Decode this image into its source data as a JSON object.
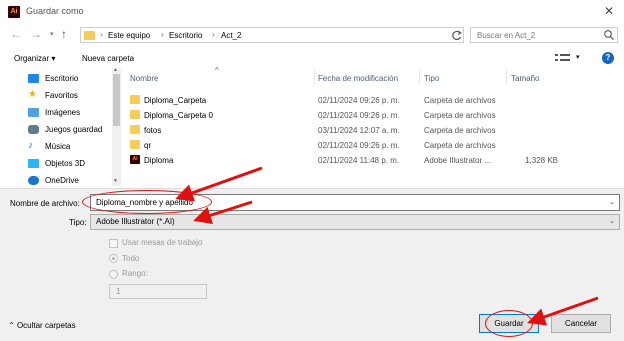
{
  "window": {
    "title": "Guardar como",
    "app_icon_text": "Ai",
    "close_glyph": "✕"
  },
  "nav": {
    "breadcrumbs": [
      "Este equipo",
      "Escritorio",
      "Act_2"
    ],
    "separator": "›",
    "search_placeholder": "Buscar en Act_2"
  },
  "toolbar": {
    "organize_label": "Organizar ▾",
    "new_folder_label": "Nueva carpeta",
    "help_label": "?"
  },
  "sidebar": {
    "items": [
      {
        "label": "Escritorio",
        "icon": "desktop-icon",
        "color": "#1e88e5"
      },
      {
        "label": "Favoritos",
        "icon": "star-icon",
        "color": "#f4b400"
      },
      {
        "label": "Imágenes",
        "icon": "pictures-icon",
        "color": "#4fa3e0"
      },
      {
        "label": "Juegos guardad",
        "icon": "saved-games-icon",
        "color": "#607d8b"
      },
      {
        "label": "Música",
        "icon": "music-icon",
        "color": "#1976d2"
      },
      {
        "label": "Objetos 3D",
        "icon": "objects-3d-icon",
        "color": "#29b6f6"
      },
      {
        "label": "OneDrive",
        "icon": "cloud-icon",
        "color": "#1976d2"
      }
    ]
  },
  "file_list": {
    "columns": [
      "Nombre",
      "Fecha de modificación",
      "Tipo",
      "Tamaño"
    ],
    "rows": [
      {
        "name": "Diploma_Carpeta",
        "date": "02/11/2024 09:26 p. m.",
        "type": "Carpeta de archivos",
        "size": "",
        "icon": "folder-icon"
      },
      {
        "name": "Diploma_Carpeta 0",
        "date": "02/11/2024 09:26 p. m.",
        "type": "Carpeta de archivos",
        "size": "",
        "icon": "folder-icon"
      },
      {
        "name": "fotos",
        "date": "03/11/2024 12:07 a. m.",
        "type": "Carpeta de archivos",
        "size": "",
        "icon": "folder-icon"
      },
      {
        "name": "qr",
        "date": "02/11/2024 09:26 p. m.",
        "type": "Carpeta de archivos",
        "size": "",
        "icon": "folder-icon"
      },
      {
        "name": "Diploma",
        "date": "02/11/2024 11:48 p. m.",
        "type": "Adobe Illustrator ...",
        "size": "1,328 KB",
        "icon": "illustrator-file-icon"
      }
    ]
  },
  "save_form": {
    "filename_label": "Nombre de archivo:",
    "filename_value": "Diploma_nombre y apellido",
    "type_label": "Tipo:",
    "type_value": "Adobe Illustrator (*.AI)",
    "artboards_checkbox_label": "Usar mesas de trabajo",
    "radio_all_label": "Todo",
    "radio_range_label": "Rango:",
    "range_value": "1"
  },
  "footer": {
    "hide_folders_label": "Ocultar carpetas",
    "save_label": "Guardar",
    "cancel_label": "Cancelar"
  },
  "colors": {
    "annotation": "#e01010",
    "accent": "#0078d7"
  }
}
